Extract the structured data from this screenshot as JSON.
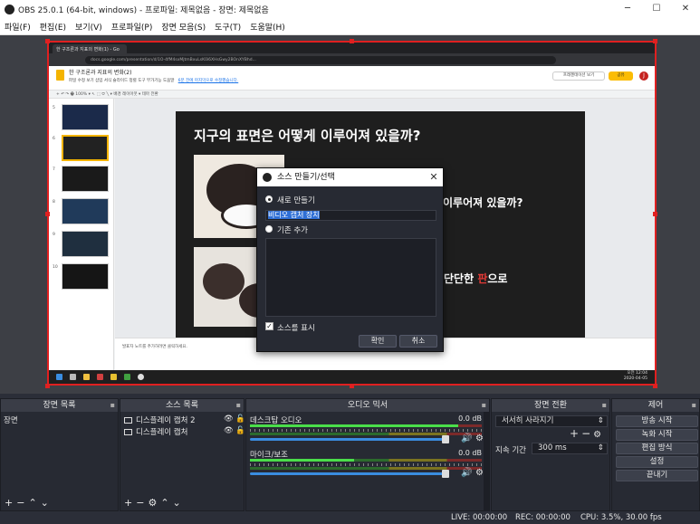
{
  "window": {
    "title": "OBS 25.0.1 (64-bit, windows) - 프로파일: 제목없음 - 장면: 제목없음",
    "controls": [
      "minimize",
      "maximize",
      "close"
    ]
  },
  "menu": [
    "파일(F)",
    "편집(E)",
    "보기(V)",
    "프로파일(P)",
    "장면 모음(S)",
    "도구(T)",
    "도움말(H)"
  ],
  "preview": {
    "browser_tab": "한 구조론과 지표의 변화(1) - Go",
    "url": "docs.google.com/presentation/d/1O-4fM4sxMjtmBxuLsK0i6XHsGwy2BOnXYBhd...",
    "doc_title": "한 구조론과 지표의 변화(2)",
    "doc_menu": "파일 수정 보기 삽입 서식 슬라이드 정렬 도구 부가기능 도움말",
    "doc_saved": "6분 전에 마지막으로 수정했습니다.",
    "present_label": "프레젠테이션 보기",
    "share_label": "공유",
    "avatar_letter": "J",
    "toolbar_text": "+ ↶ ↷ 🖶 100% ▾   ↖ ⬚ ⬭ ╲ ▾   배경   레이아웃 ▾   테마   전환",
    "slide_numbers": [
      "5",
      "6",
      "7",
      "8",
      "9",
      "10"
    ],
    "slide_title": "지구의 표면은 어떻게 이루어져 있을까?",
    "slide_text2": "이루어져 있을까?",
    "slide_text3_pre": "단단한 ",
    "slide_text3_red": "판",
    "slide_text3_post": "으로",
    "notes_placeholder": "발표자 노트를 추가하려면 클릭하세요.",
    "clock_time": "오전 12:04",
    "clock_date": "2020-04-05"
  },
  "dialog": {
    "title": "소스 만들기/선택",
    "radio_new": "새로 만들기",
    "input_value": "비디오 캡처 장치",
    "radio_existing": "기존 추가",
    "checkbox_label": "소스를 표시",
    "checkbox_checked": true,
    "ok": "확인",
    "cancel": "취소"
  },
  "scenes": {
    "header": "장면 목록",
    "items": [
      "장면"
    ]
  },
  "sources": {
    "header": "소스 목록",
    "items": [
      {
        "name": "디스플레이 캡처 2",
        "visible": true,
        "locked": false
      },
      {
        "name": "디스플레이 캡처",
        "visible": true,
        "locked": false
      }
    ]
  },
  "mixer": {
    "header": "오디오 믹서",
    "channels": [
      {
        "name": "데스크탑 오디오",
        "db": "0.0 dB",
        "level": 0.9,
        "volume": 1.0
      },
      {
        "name": "마이크/보조",
        "db": "0.0 dB",
        "level": 0.45,
        "volume": 1.0
      }
    ]
  },
  "transitions": {
    "header": "장면 전환",
    "selected": "서서히 사라지기",
    "duration_label": "지속 기간",
    "duration_value": "300 ms"
  },
  "controls": {
    "header": "제어",
    "buttons": [
      "방송 시작",
      "녹화 시작",
      "편집 방식",
      "설정",
      "끝내기"
    ]
  },
  "status": {
    "live": "LIVE: 00:00:00",
    "rec": "REC: 00:00:00",
    "cpu": "CPU: 3.5%, 30.00 fps"
  },
  "colors": {
    "selection": "#e02020",
    "dock_bg": "#272a33",
    "accent": "#3a8de0",
    "slide_red": "#e53935"
  }
}
